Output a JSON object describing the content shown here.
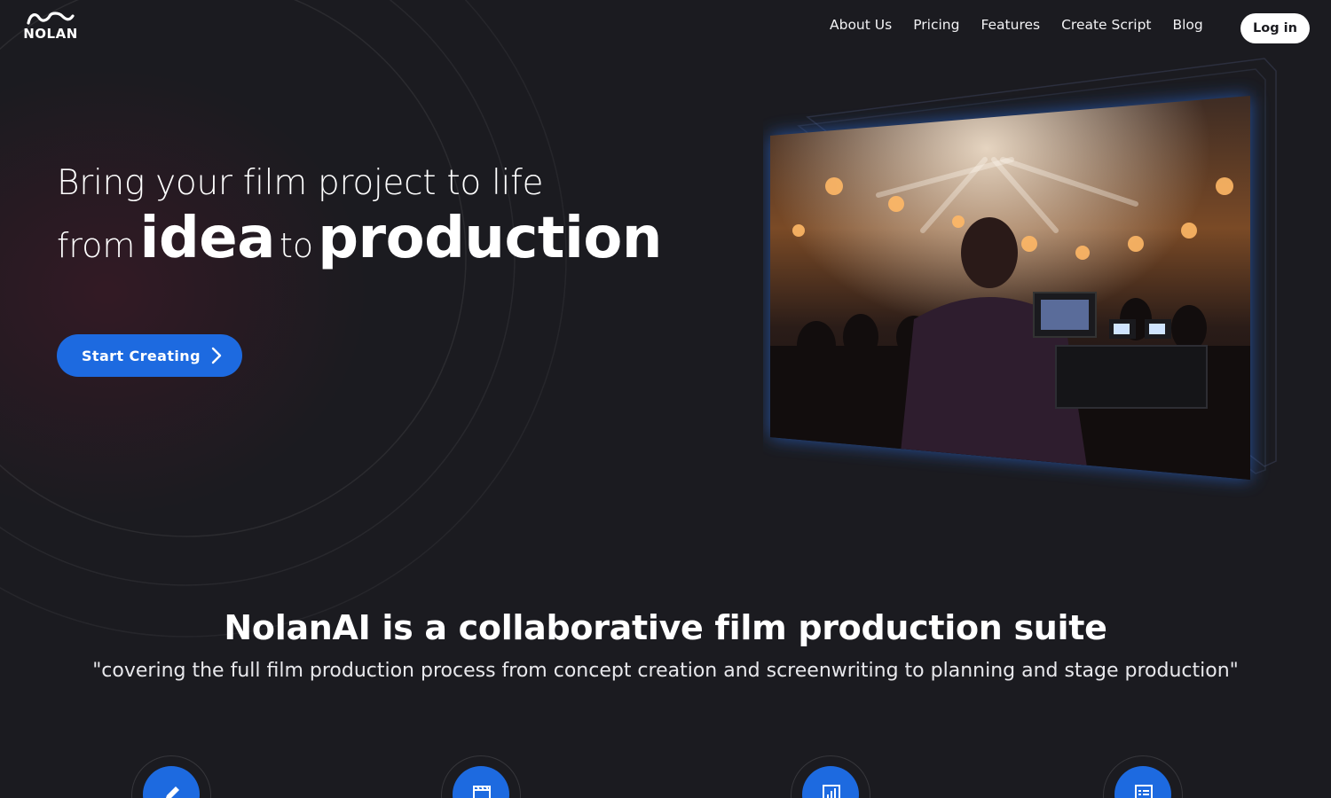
{
  "brand": {
    "logo_text": "NOLAN",
    "accent": "#1d6ae0",
    "background": "#1b1b20"
  },
  "nav": {
    "items": [
      "About Us",
      "Pricing",
      "Features",
      "Create Script",
      "Blog"
    ],
    "login_label": "Log in"
  },
  "hero": {
    "line1": "Bring your film project to life",
    "from": "from",
    "idea": "idea",
    "to": "to",
    "production": "production",
    "cta_label": "Start Creating",
    "cta_icon": "chevron-right-icon",
    "image": "film-set-stage-image"
  },
  "mission": {
    "title": "NolanAI is a collaborative film production suite",
    "quote": "\"covering the full film production process from concept creation and screenwriting to planning and stage production\""
  },
  "features": {
    "icons": [
      "pencil-icon",
      "clapperboard-icon",
      "chart-icon",
      "list-icon"
    ]
  }
}
